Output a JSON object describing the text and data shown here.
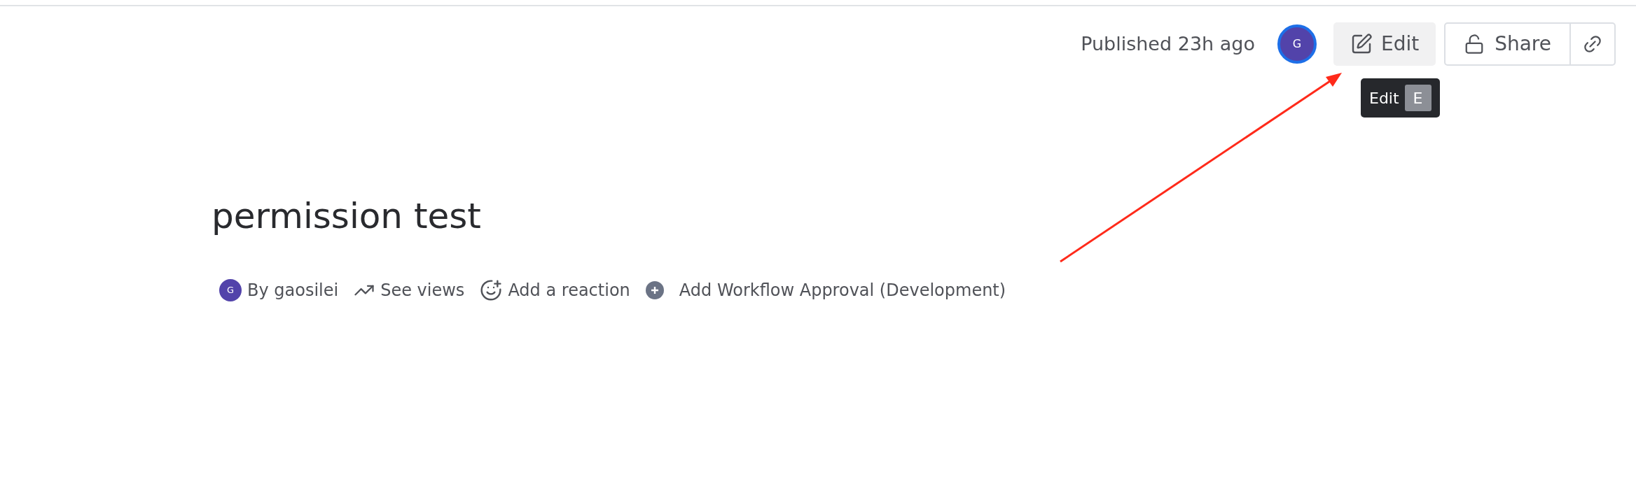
{
  "header": {
    "status": "Published 23h ago",
    "avatar": "G",
    "edit_button": "Edit",
    "share_button": "Share"
  },
  "tooltip": {
    "label": "Edit",
    "shortcut": "E"
  },
  "page": {
    "title": "permission test"
  },
  "meta": [
    {
      "kind": "author",
      "avatar": "G",
      "label": "By gaosilei"
    },
    {
      "kind": "views",
      "label": "See views"
    },
    {
      "kind": "reaction",
      "label": "Add a reaction"
    },
    {
      "kind": "workflow",
      "label": "Add Workflow Approval (Development)"
    }
  ]
}
